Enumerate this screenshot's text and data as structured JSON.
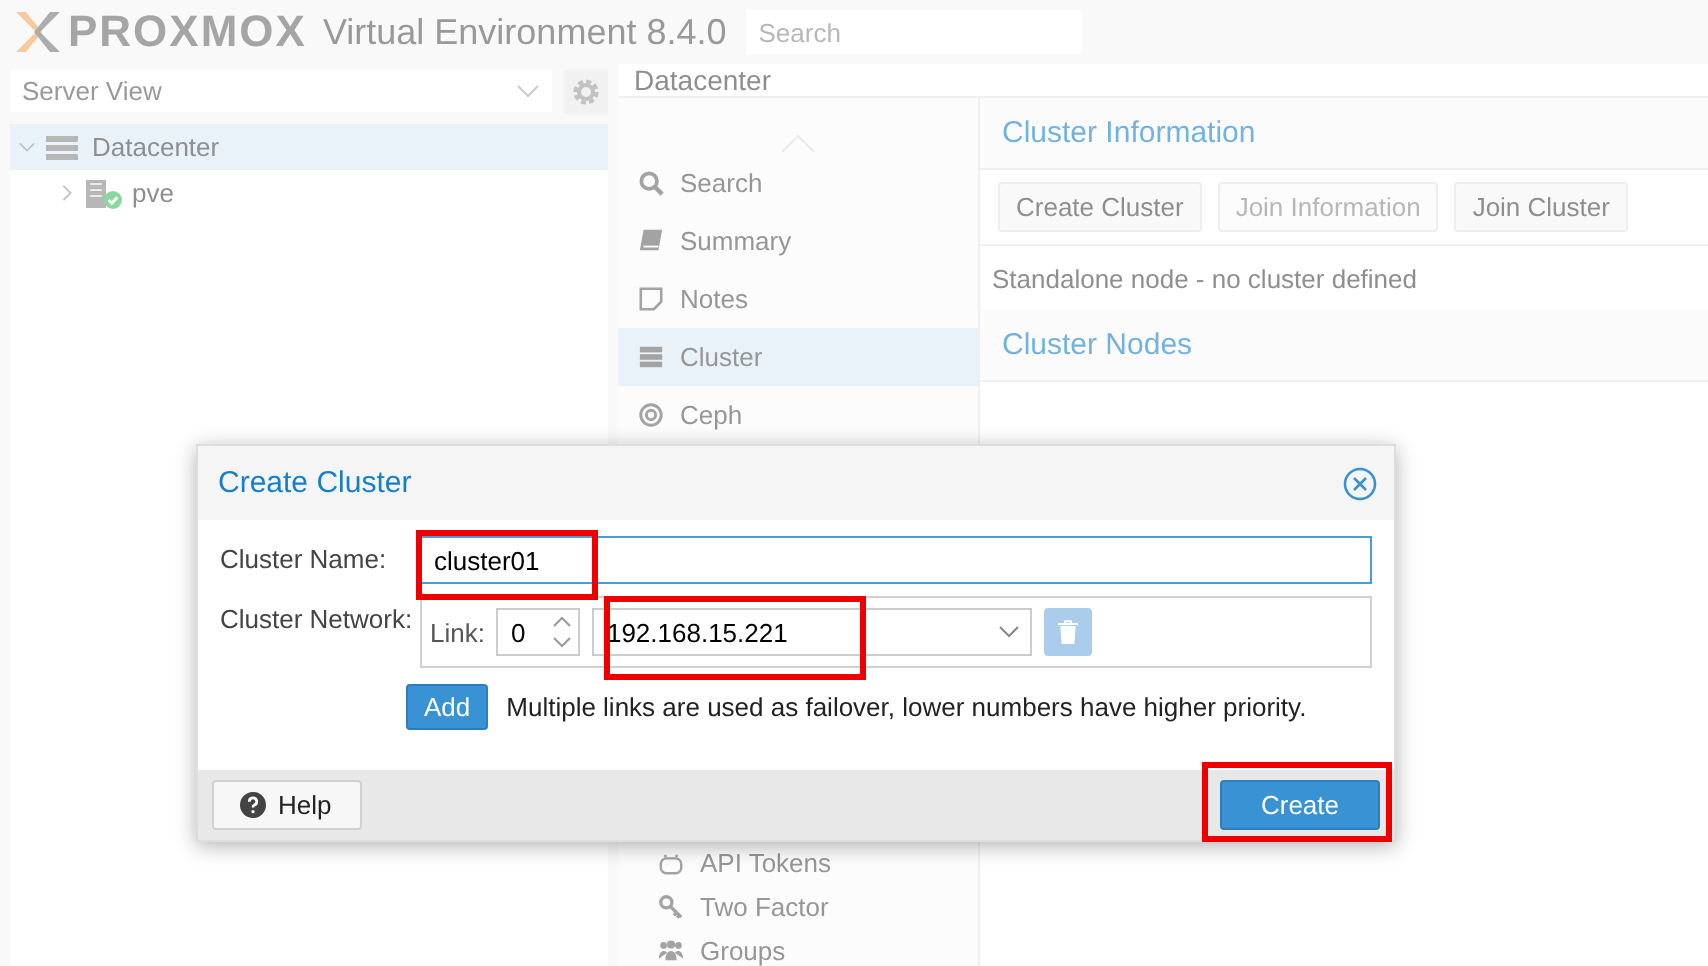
{
  "header": {
    "logo": "PROXMOX",
    "product": "Virtual Environment 8.4.0",
    "search": {
      "placeholder": "Search"
    }
  },
  "view_selector": {
    "value": "Server View"
  },
  "tree": [
    {
      "label": "Datacenter",
      "selected": true,
      "expanded": true,
      "children": [
        {
          "label": "pve",
          "selected": false,
          "expanded": false
        }
      ]
    }
  ],
  "breadcrumb": "Datacenter",
  "nav_items": [
    {
      "label": "Search",
      "selected": false
    },
    {
      "label": "Summary",
      "selected": false
    },
    {
      "label": "Notes",
      "selected": false
    },
    {
      "label": "Cluster",
      "selected": true
    },
    {
      "label": "Ceph",
      "selected": false
    }
  ],
  "nav_items_lower": [
    {
      "label": "API Tokens",
      "selected": false
    },
    {
      "label": "Two Factor",
      "selected": false
    },
    {
      "label": "Groups",
      "selected": false
    }
  ],
  "cluster_information": {
    "title": "Cluster Information",
    "buttons": [
      {
        "label": "Create Cluster",
        "disabled": false
      },
      {
        "label": "Join Information",
        "disabled": true
      },
      {
        "label": "Join Cluster",
        "disabled": false
      }
    ],
    "status": "Standalone node - no cluster defined"
  },
  "cluster_nodes": {
    "title": "Cluster Nodes"
  },
  "dialog": {
    "title": "Create Cluster",
    "cluster_name": {
      "label": "Cluster Name:",
      "value": "cluster01",
      "highlighted": true
    },
    "cluster_network": {
      "label": "Cluster Network:",
      "links": [
        {
          "label": "Link:",
          "number": "0",
          "address": "192.168.15.221",
          "highlighted": true
        }
      ],
      "add_button": "Add",
      "hint": "Multiple links are used as failover, lower numbers have higher priority."
    },
    "help_button": "Help",
    "create_button": {
      "label": "Create",
      "highlighted": true
    }
  }
}
